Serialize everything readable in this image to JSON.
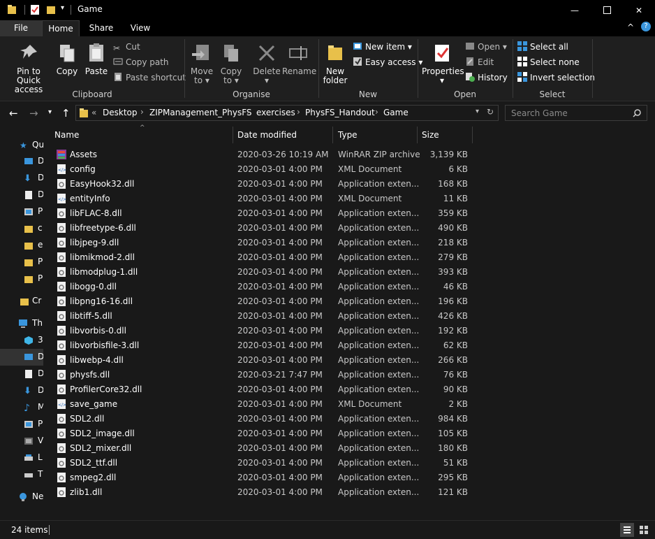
{
  "window": {
    "title": "Game",
    "minimize_glyph": "—",
    "maximize_glyph": "☐",
    "close_glyph": "✕"
  },
  "tabs": [
    {
      "label": "File"
    },
    {
      "label": "Home"
    },
    {
      "label": "Share"
    },
    {
      "label": "View"
    }
  ],
  "ribbon": {
    "collapse_glyph": "^",
    "help_glyph": "?",
    "clipboard": {
      "label": "Clipboard",
      "pin_label_1": "Pin to Quick",
      "pin_label_2": "access",
      "copy": "Copy",
      "paste": "Paste",
      "cut": "Cut",
      "copy_path": "Copy path",
      "paste_shortcut": "Paste shortcut"
    },
    "organise": {
      "label": "Organise",
      "move_to_1": "Move",
      "move_to_2": "to",
      "copy_to_1": "Copy",
      "copy_to_2": "to",
      "delete": "Delete",
      "rename": "Rename"
    },
    "new": {
      "label": "New",
      "new_folder_1": "New",
      "new_folder_2": "folder",
      "new_item": "New item",
      "easy_access": "Easy access"
    },
    "open": {
      "label": "Open",
      "properties": "Properties",
      "open": "Open",
      "edit": "Edit",
      "history": "History"
    },
    "select": {
      "label": "Select",
      "select_all": "Select all",
      "select_none": "Select none",
      "invert_selection": "Invert selection"
    }
  },
  "address": {
    "overflow": "«",
    "crumbs": [
      "Desktop",
      "ZIPManagement_PhysFS",
      "exercises",
      "PhysFS_Handout",
      "Game"
    ],
    "search_placeholder": "Search Game"
  },
  "navpane": {
    "items": [
      {
        "label": "Qu"
      },
      {
        "label": "D"
      },
      {
        "label": "D"
      },
      {
        "label": "D"
      },
      {
        "label": "P"
      },
      {
        "label": "c"
      },
      {
        "label": "e"
      },
      {
        "label": "P"
      },
      {
        "label": "P"
      },
      {
        "label": "Cr"
      },
      {
        "label": "Th"
      },
      {
        "label": "3"
      },
      {
        "label": "D"
      },
      {
        "label": "D"
      },
      {
        "label": "D"
      },
      {
        "label": "M"
      },
      {
        "label": "P"
      },
      {
        "label": "V"
      },
      {
        "label": "L"
      },
      {
        "label": "T"
      },
      {
        "label": "Ne"
      }
    ]
  },
  "columns": {
    "name": "Name",
    "date": "Date modified",
    "type": "Type",
    "size": "Size",
    "sort_glyph": "^"
  },
  "files": [
    {
      "name": "Assets",
      "date": "2020-03-26 10:19 AM",
      "type": "WinRAR ZIP archive",
      "size": "3,139 KB",
      "kind": "zip"
    },
    {
      "name": "config",
      "date": "2020-03-01 4:00 PM",
      "type": "XML Document",
      "size": "6 KB",
      "kind": "xml"
    },
    {
      "name": "EasyHook32.dll",
      "date": "2020-03-01 4:00 PM",
      "type": "Application exten...",
      "size": "168 KB",
      "kind": "dll"
    },
    {
      "name": "entityInfo",
      "date": "2020-03-01 4:00 PM",
      "type": "XML Document",
      "size": "11 KB",
      "kind": "xml"
    },
    {
      "name": "libFLAC-8.dll",
      "date": "2020-03-01 4:00 PM",
      "type": "Application exten...",
      "size": "359 KB",
      "kind": "dll"
    },
    {
      "name": "libfreetype-6.dll",
      "date": "2020-03-01 4:00 PM",
      "type": "Application exten...",
      "size": "490 KB",
      "kind": "dll"
    },
    {
      "name": "libjpeg-9.dll",
      "date": "2020-03-01 4:00 PM",
      "type": "Application exten...",
      "size": "218 KB",
      "kind": "dll"
    },
    {
      "name": "libmikmod-2.dll",
      "date": "2020-03-01 4:00 PM",
      "type": "Application exten...",
      "size": "279 KB",
      "kind": "dll"
    },
    {
      "name": "libmodplug-1.dll",
      "date": "2020-03-01 4:00 PM",
      "type": "Application exten...",
      "size": "393 KB",
      "kind": "dll"
    },
    {
      "name": "libogg-0.dll",
      "date": "2020-03-01 4:00 PM",
      "type": "Application exten...",
      "size": "46 KB",
      "kind": "dll"
    },
    {
      "name": "libpng16-16.dll",
      "date": "2020-03-01 4:00 PM",
      "type": "Application exten...",
      "size": "196 KB",
      "kind": "dll"
    },
    {
      "name": "libtiff-5.dll",
      "date": "2020-03-01 4:00 PM",
      "type": "Application exten...",
      "size": "426 KB",
      "kind": "dll"
    },
    {
      "name": "libvorbis-0.dll",
      "date": "2020-03-01 4:00 PM",
      "type": "Application exten...",
      "size": "192 KB",
      "kind": "dll"
    },
    {
      "name": "libvorbisfile-3.dll",
      "date": "2020-03-01 4:00 PM",
      "type": "Application exten...",
      "size": "62 KB",
      "kind": "dll"
    },
    {
      "name": "libwebp-4.dll",
      "date": "2020-03-01 4:00 PM",
      "type": "Application exten...",
      "size": "266 KB",
      "kind": "dll"
    },
    {
      "name": "physfs.dll",
      "date": "2020-03-21 7:47 PM",
      "type": "Application exten...",
      "size": "76 KB",
      "kind": "dll"
    },
    {
      "name": "ProfilerCore32.dll",
      "date": "2020-03-01 4:00 PM",
      "type": "Application exten...",
      "size": "90 KB",
      "kind": "dll"
    },
    {
      "name": "save_game",
      "date": "2020-03-01 4:00 PM",
      "type": "XML Document",
      "size": "2 KB",
      "kind": "xml"
    },
    {
      "name": "SDL2.dll",
      "date": "2020-03-01 4:00 PM",
      "type": "Application exten...",
      "size": "984 KB",
      "kind": "dll"
    },
    {
      "name": "SDL2_image.dll",
      "date": "2020-03-01 4:00 PM",
      "type": "Application exten...",
      "size": "105 KB",
      "kind": "dll"
    },
    {
      "name": "SDL2_mixer.dll",
      "date": "2020-03-01 4:00 PM",
      "type": "Application exten...",
      "size": "180 KB",
      "kind": "dll"
    },
    {
      "name": "SDL2_ttf.dll",
      "date": "2020-03-01 4:00 PM",
      "type": "Application exten...",
      "size": "51 KB",
      "kind": "dll"
    },
    {
      "name": "smpeg2.dll",
      "date": "2020-03-01 4:00 PM",
      "type": "Application exten...",
      "size": "295 KB",
      "kind": "dll"
    },
    {
      "name": "zlib1.dll",
      "date": "2020-03-01 4:00 PM",
      "type": "Application exten...",
      "size": "121 KB",
      "kind": "dll"
    }
  ],
  "status": {
    "item_count": "24 items"
  },
  "colors": {
    "background": "#191919",
    "ribbon": "#1f1f1f",
    "accent_blue": "#3a96dd",
    "folder_yellow": "#e8c04a"
  }
}
